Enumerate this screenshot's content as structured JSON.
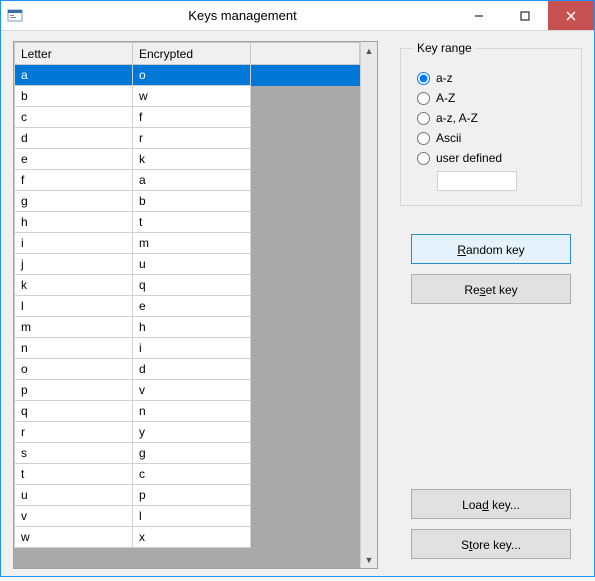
{
  "window": {
    "title": "Keys management"
  },
  "grid": {
    "columns": {
      "letter": "Letter",
      "encrypted": "Encrypted"
    },
    "rows": [
      {
        "letter": "a",
        "encrypted": "o"
      },
      {
        "letter": "b",
        "encrypted": "w"
      },
      {
        "letter": "c",
        "encrypted": "f"
      },
      {
        "letter": "d",
        "encrypted": "r"
      },
      {
        "letter": "e",
        "encrypted": "k"
      },
      {
        "letter": "f",
        "encrypted": "a"
      },
      {
        "letter": "g",
        "encrypted": "b"
      },
      {
        "letter": "h",
        "encrypted": "t"
      },
      {
        "letter": "i",
        "encrypted": "m"
      },
      {
        "letter": "j",
        "encrypted": "u"
      },
      {
        "letter": "k",
        "encrypted": "q"
      },
      {
        "letter": "l",
        "encrypted": "e"
      },
      {
        "letter": "m",
        "encrypted": "h"
      },
      {
        "letter": "n",
        "encrypted": "i"
      },
      {
        "letter": "o",
        "encrypted": "d"
      },
      {
        "letter": "p",
        "encrypted": "v"
      },
      {
        "letter": "q",
        "encrypted": "n"
      },
      {
        "letter": "r",
        "encrypted": "y"
      },
      {
        "letter": "s",
        "encrypted": "g"
      },
      {
        "letter": "t",
        "encrypted": "c"
      },
      {
        "letter": "u",
        "encrypted": "p"
      },
      {
        "letter": "v",
        "encrypted": "l"
      },
      {
        "letter": "w",
        "encrypted": "x"
      }
    ],
    "selected_row_index": 0
  },
  "keyrange": {
    "legend": "Key range",
    "options": {
      "az": "a-z",
      "AZ": "A-Z",
      "azAZ": "a-z, A-Z",
      "ascii": "Ascii",
      "userdef": "user defined"
    },
    "selected": "az",
    "userdef_value": ""
  },
  "buttons": {
    "random": {
      "pre": "",
      "mn": "R",
      "post": "andom key"
    },
    "reset": {
      "pre": "Re",
      "mn": "s",
      "post": "et key"
    },
    "load": {
      "pre": "Loa",
      "mn": "d",
      "post": " key..."
    },
    "store": {
      "pre": "S",
      "mn": "t",
      "post": "ore key..."
    }
  }
}
